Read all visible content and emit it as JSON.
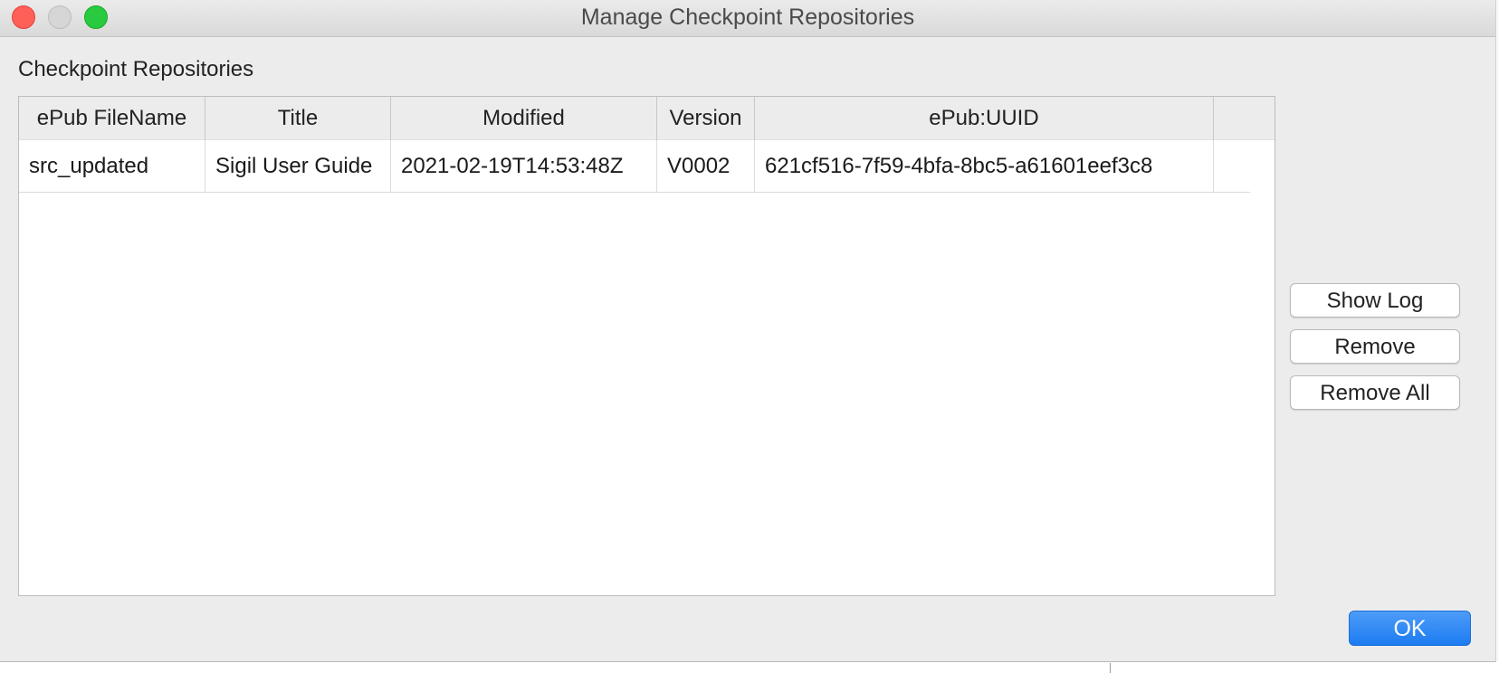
{
  "window": {
    "title": "Manage Checkpoint Repositories"
  },
  "group": {
    "label": "Checkpoint Repositories"
  },
  "table": {
    "columns": [
      "ePub FileName",
      "Title",
      "Modified",
      "Version",
      "ePub:UUID"
    ],
    "rows": [
      {
        "filename": "src_updated",
        "title": "Sigil User Guide",
        "modified": "2021-02-19T14:53:48Z",
        "version": "V0002",
        "uuid": "621cf516-7f59-4bfa-8bc5-a61601eef3c8"
      }
    ]
  },
  "buttons": {
    "show_log": "Show Log",
    "remove": "Remove",
    "remove_all": "Remove All",
    "ok": "OK"
  },
  "colors": {
    "ok_button": "#1d7cf2",
    "close": "#fe5f57",
    "zoom": "#29c940"
  }
}
